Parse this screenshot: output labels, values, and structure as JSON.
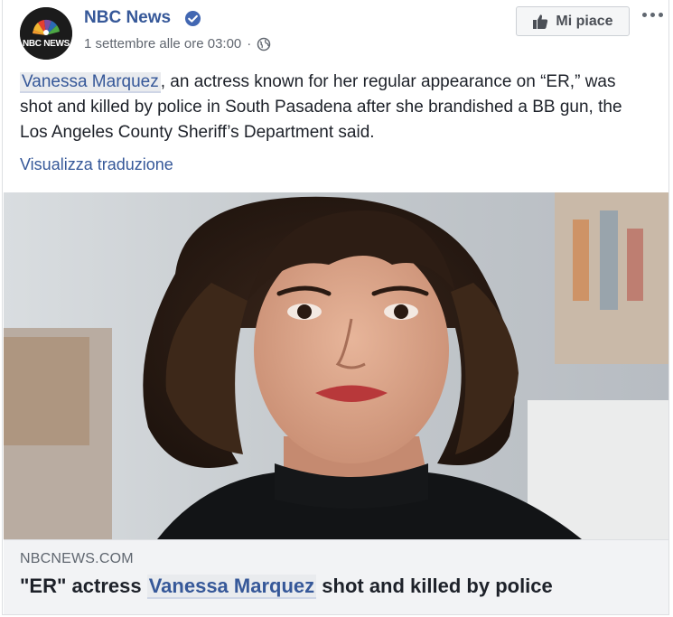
{
  "header": {
    "page_name": "NBC News",
    "avatar_text": "NBC NEWS",
    "timestamp": "1 settembre alle ore 03:00",
    "separator": "·",
    "privacy_icon": "globe-icon",
    "verified_icon": "verified-badge-icon",
    "like_label": "Mi piace",
    "more_icon": "ellipsis-icon"
  },
  "post": {
    "mention": "Vanessa Marquez",
    "text_after_mention": ", an actress known for her regular appearance on “ER,” was shot and killed by police in South Pasadena after she brandished a BB gun, the Los Angeles County Sheriff’s Department said.",
    "translate_label": "Visualizza traduzione"
  },
  "link_preview": {
    "domain": "NBCNEWS.COM",
    "title_before": "\"ER\" actress ",
    "title_mention": "Vanessa Marquez",
    "title_after": " shot and killed by police"
  },
  "colors": {
    "link_blue": "#365899",
    "text": "#1d2129",
    "meta_gray": "#616770",
    "footer_bg": "#f2f3f5"
  }
}
